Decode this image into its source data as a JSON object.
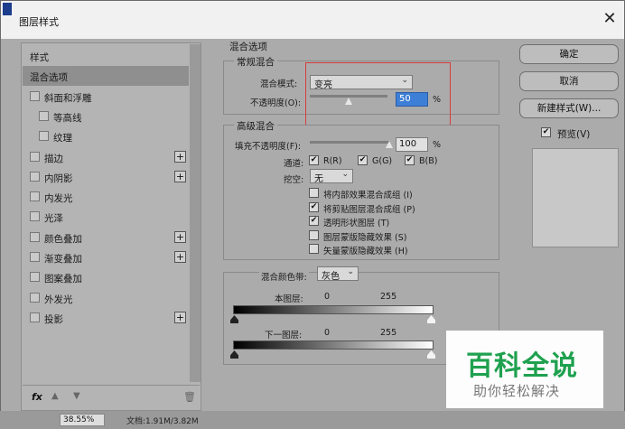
{
  "window": {
    "title": "图层样式"
  },
  "left_panel": {
    "items": [
      {
        "label": "样式",
        "checkbox": false,
        "plus": false,
        "indent": 0,
        "selected": false
      },
      {
        "label": "混合选项",
        "checkbox": false,
        "plus": false,
        "indent": 0,
        "selected": true
      },
      {
        "label": "斜面和浮雕",
        "checkbox": true,
        "plus": false,
        "indent": 0,
        "selected": false
      },
      {
        "label": "等高线",
        "checkbox": true,
        "plus": false,
        "indent": 1,
        "selected": false
      },
      {
        "label": "纹理",
        "checkbox": true,
        "plus": false,
        "indent": 1,
        "selected": false
      },
      {
        "label": "描边",
        "checkbox": true,
        "plus": true,
        "indent": 0,
        "selected": false
      },
      {
        "label": "内阴影",
        "checkbox": true,
        "plus": true,
        "indent": 0,
        "selected": false
      },
      {
        "label": "内发光",
        "checkbox": true,
        "plus": false,
        "indent": 0,
        "selected": false
      },
      {
        "label": "光泽",
        "checkbox": true,
        "plus": false,
        "indent": 0,
        "selected": false
      },
      {
        "label": "颜色叠加",
        "checkbox": true,
        "plus": true,
        "indent": 0,
        "selected": false
      },
      {
        "label": "渐变叠加",
        "checkbox": true,
        "plus": true,
        "indent": 0,
        "selected": false
      },
      {
        "label": "图案叠加",
        "checkbox": true,
        "plus": false,
        "indent": 0,
        "selected": false
      },
      {
        "label": "外发光",
        "checkbox": true,
        "plus": false,
        "indent": 0,
        "selected": false
      },
      {
        "label": "投影",
        "checkbox": true,
        "plus": true,
        "indent": 0,
        "selected": false
      }
    ],
    "bottom": {
      "fx": "fx",
      "up_icon": "arrow-up-icon",
      "down_icon": "arrow-down-icon",
      "trash_icon": "trash-icon"
    }
  },
  "blending_options": {
    "title": "混合选项",
    "general": {
      "title": "常规混合",
      "blend_mode_label": "混合模式:",
      "blend_mode_value": "变亮",
      "opacity_label": "不透明度(O):",
      "opacity_value": "50",
      "opacity_unit": "%",
      "opacity_fraction": 0.5
    },
    "advanced": {
      "title": "高级混合",
      "fill_label": "填充不透明度(F):",
      "fill_value": "100",
      "fill_unit": "%",
      "fill_fraction": 1.0,
      "channels_label": "通道:",
      "channels": [
        {
          "label": "R(R)",
          "checked": true
        },
        {
          "label": "G(G)",
          "checked": true
        },
        {
          "label": "B(B)",
          "checked": true
        }
      ],
      "knockout_label": "挖空:",
      "knockout_value": "无",
      "options": [
        {
          "label": "将内部效果混合成组 (I)",
          "checked": false
        },
        {
          "label": "将剪贴图层混合成组 (P)",
          "checked": true
        },
        {
          "label": "透明形状图层 (T)",
          "checked": true
        },
        {
          "label": "图层蒙版隐藏效果 (S)",
          "checked": false
        },
        {
          "label": "矢量蒙版隐藏效果 (H)",
          "checked": false
        }
      ]
    },
    "blend_if": {
      "label": "混合颜色带:",
      "value": "灰色",
      "this_layer_label": "本图层:",
      "this_layer_min": "0",
      "this_layer_max": "255",
      "under_layer_label": "下一图层:",
      "under_layer_min": "0",
      "under_layer_max": "255"
    }
  },
  "buttons": {
    "ok": "确定",
    "cancel": "取消",
    "new_style": "新建样式(W)...",
    "preview_label": "预览(V)",
    "preview_checked": true
  },
  "status": {
    "zoom": "38.55%",
    "doc": "文档:1.91M/3.82M"
  },
  "watermark": {
    "title": "百科全说",
    "subtitle": "助你轻松解决"
  },
  "colors": {
    "highlight_box": "#d83b3b",
    "selected_input": "#3d7fd6",
    "watermark_green": "#1fa14f"
  }
}
